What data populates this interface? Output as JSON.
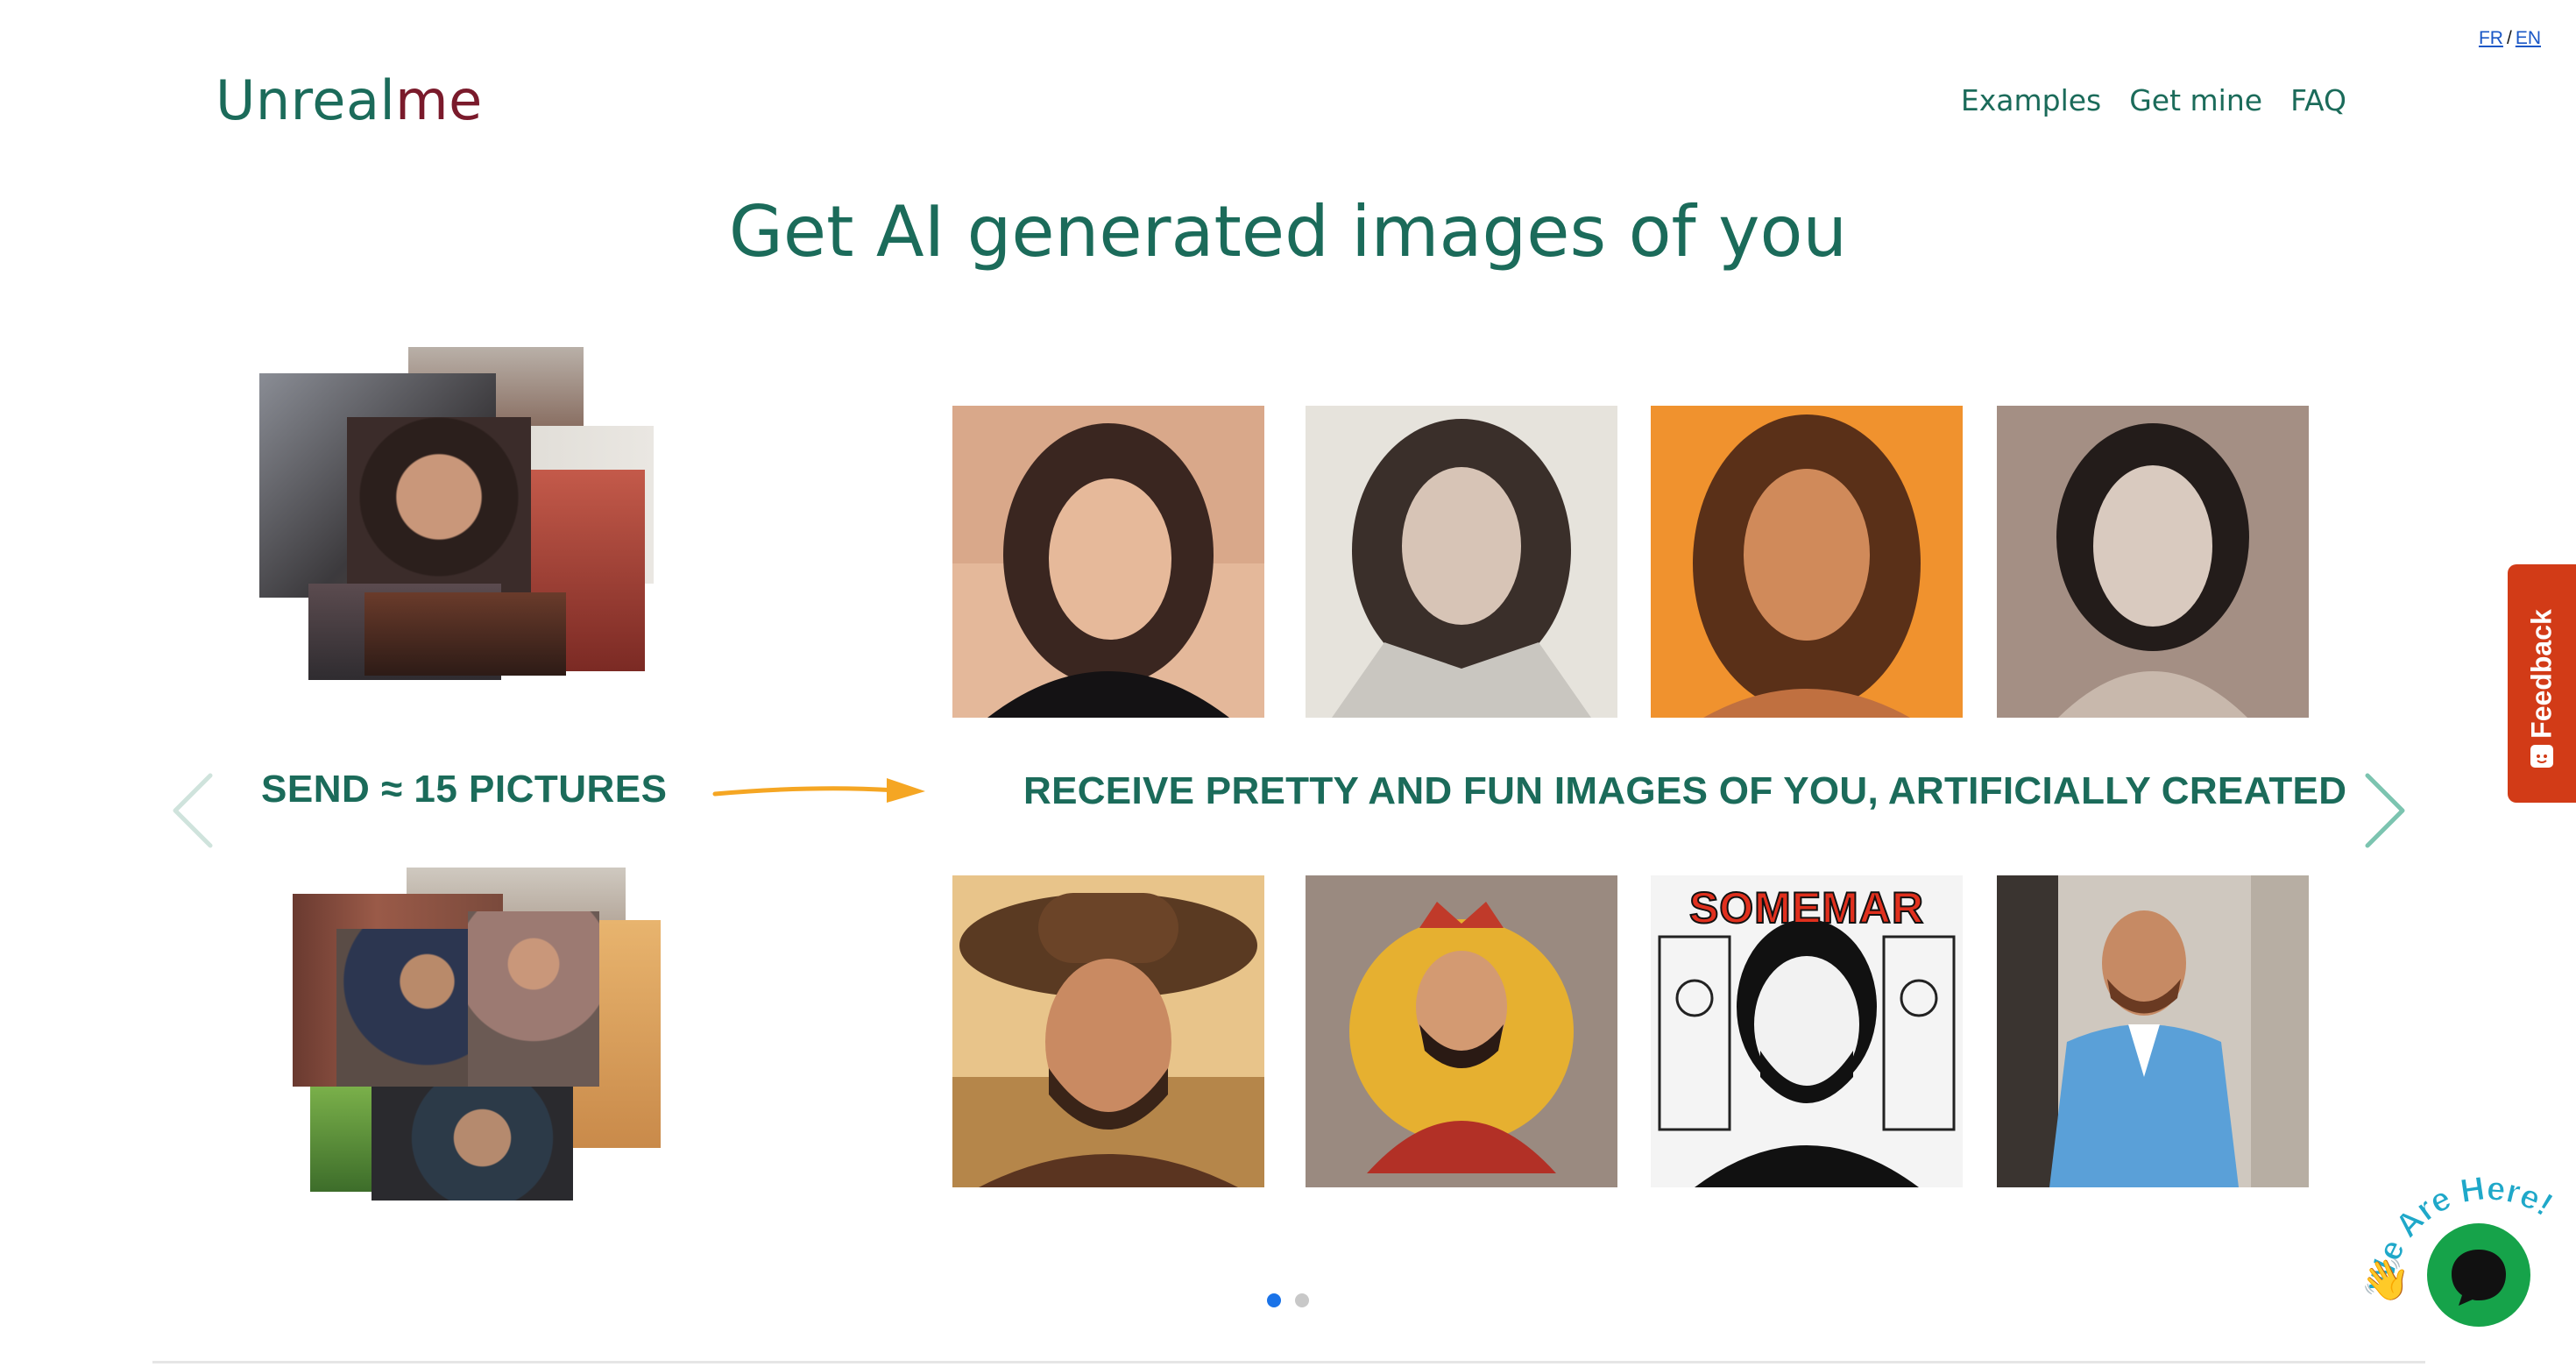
{
  "language_switch": {
    "fr": "FR",
    "separator": "/",
    "en": "EN"
  },
  "logo": {
    "part1": "Unreal",
    "part2": "me"
  },
  "nav": {
    "examples": "Examples",
    "get_mine": "Get mine",
    "faq": "FAQ"
  },
  "headline": "Get AI generated images of you",
  "carousel": {
    "send_label": "SEND ≈ 15 PICTURES",
    "receive_label": "RECEIVE PRETTY AND FUN IMAGES OF YOU, ARTIFICIALLY CREATED",
    "slides_total": 2,
    "active_slide": 1,
    "female_results": [
      "portrait-dark-hair-black-top",
      "portrait-robotic-armor",
      "portrait-orange-background",
      "portrait-pale-sketch"
    ],
    "male_results": [
      "portrait-cowboy-hat",
      "portrait-king-crown",
      "portrait-comic-cover",
      "portrait-blue-suit"
    ],
    "comic_title": "SOMEMAR"
  },
  "feedback": {
    "label": "Feedback"
  },
  "chat": {
    "badge": "We Are Here!",
    "wave": "👋"
  },
  "colors": {
    "brand_green": "#1b6b5a",
    "brand_maroon": "#7a1a2b",
    "arrow_orange": "#f5a623",
    "feedback_red": "#d23b17",
    "chat_green": "#16a34a",
    "dot_active": "#1a73e8"
  }
}
